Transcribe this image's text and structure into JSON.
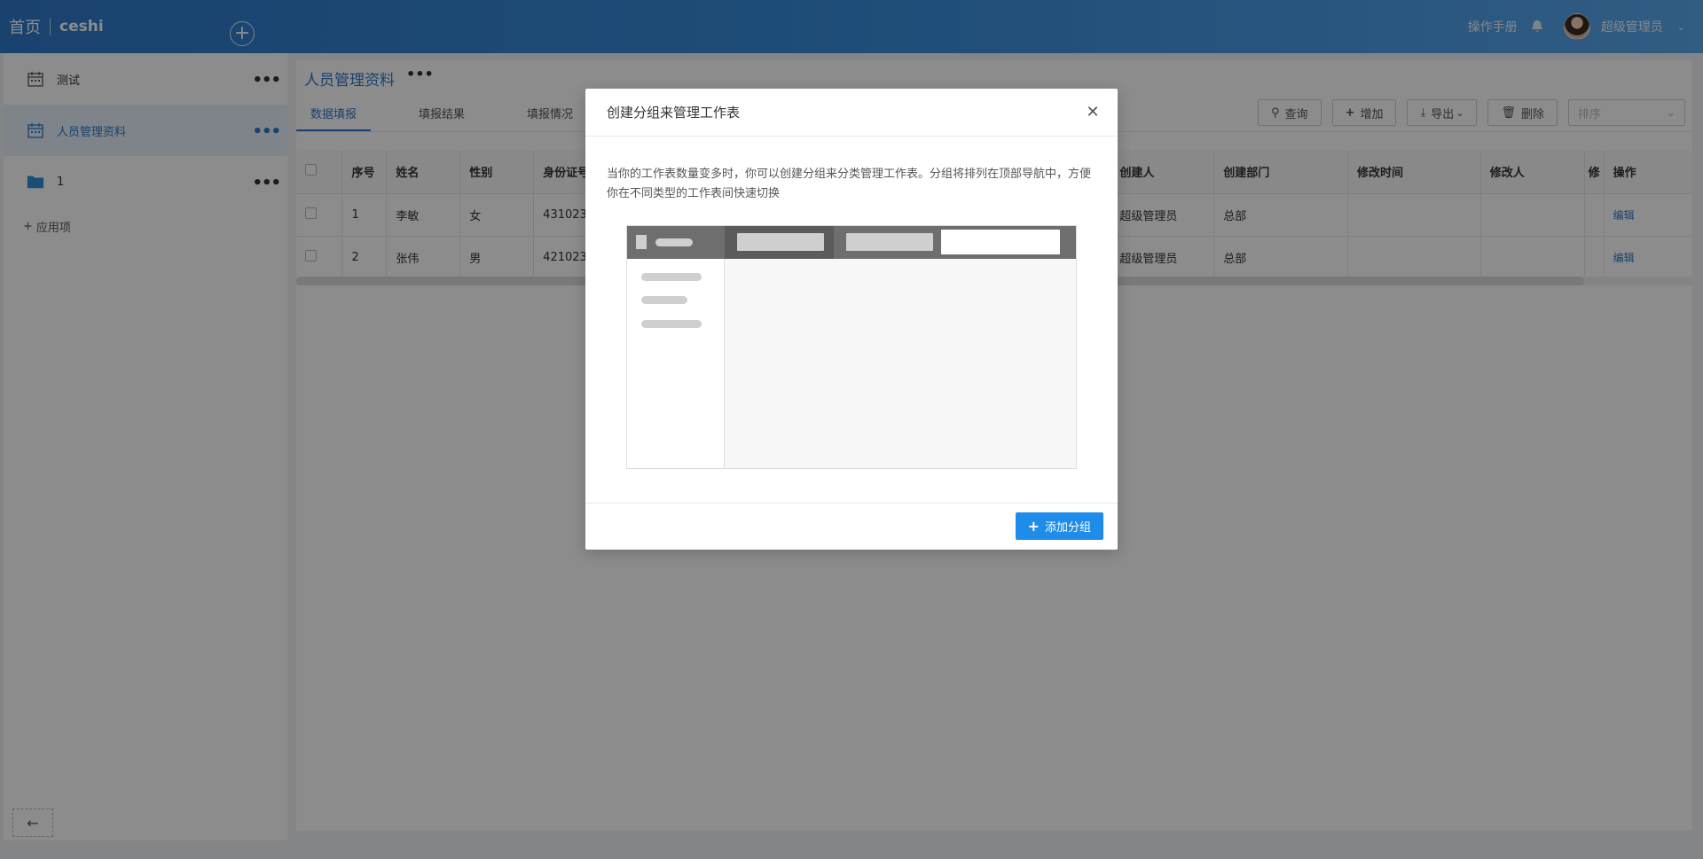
{
  "header": {
    "home": "首页",
    "app_name": "ceshi",
    "add_icon": "plus-circle-icon",
    "manual": "操作手册",
    "user": "超级管理员"
  },
  "sidebar": {
    "items": [
      {
        "label": "测试",
        "icon": "calendar-icon",
        "active": false
      },
      {
        "label": "人员管理资料",
        "icon": "calendar-icon",
        "active": true
      },
      {
        "label": "1",
        "icon": "folder-icon",
        "active": false
      }
    ],
    "add_label": "应用项"
  },
  "main": {
    "title": "人员管理资料",
    "tabs": [
      "数据填报",
      "填报结果",
      "填报情况"
    ],
    "toolbar": {
      "query": "查询",
      "add": "增加",
      "export": "导出",
      "delete": "删除",
      "sort_placeholder": "排序"
    },
    "table": {
      "columns": [
        "序号",
        "姓名",
        "性别",
        "身份证号",
        "创建人",
        "创建部门",
        "修改时间",
        "修改人",
        "修",
        "操作"
      ],
      "rows": [
        {
          "index": "1",
          "name": "李敏",
          "gender": "女",
          "id": "431023",
          "creator": "超级管理员",
          "dept": "总部",
          "modified": "",
          "modifier": "",
          "action": "编辑"
        },
        {
          "index": "2",
          "name": "张伟",
          "gender": "男",
          "id": "421023",
          "creator": "超级管理员",
          "dept": "总部",
          "modified": "",
          "modifier": "",
          "action": "编辑"
        }
      ]
    }
  },
  "modal": {
    "title": "创建分组来管理工作表",
    "description": "当你的工作表数量变多时，你可以创建分组来分类管理工作表。分组将排列在顶部导航中，方便你在不同类型的工作表间快速切换",
    "button": "添加分组"
  },
  "colors": {
    "accent": "#2f79c9",
    "primary_button": "#1e8ce8"
  }
}
